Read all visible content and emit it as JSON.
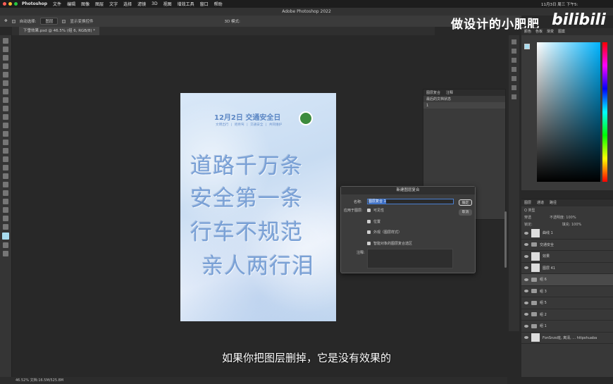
{
  "menubar": {
    "app": "Photoshop",
    "items": [
      "文件",
      "编辑",
      "图像",
      "图层",
      "文字",
      "选择",
      "滤镜",
      "3D",
      "视图",
      "增效工具",
      "窗口",
      "帮助"
    ],
    "clock": "11月3日 周三 下午5:"
  },
  "titlebar": {
    "title": "Adobe Photoshop 2022"
  },
  "options": {
    "auto_select": "自动选择:",
    "target": "图层",
    "show_transform": "显示变换控件",
    "mode3d": "3D 模式:"
  },
  "doc_tab": "下雪效果.psd @ 46.5% (组 6, RGB/8) *",
  "watermark": "做设计的小肥肥",
  "bili": "bilibili",
  "poster": {
    "heading": "12月2日 交通安全日",
    "sub": "文明出行 | 拒绝驾 | 交通安全 | 共同维护",
    "lines": [
      "道路千万条",
      "安全第一条",
      "行车不规范",
      "亲人两行泪"
    ]
  },
  "history": {
    "tabs": [
      "图层复合",
      "注释"
    ],
    "rows": [
      "最后的文档状态",
      "1"
    ]
  },
  "dialog": {
    "title": "新建图层复合",
    "name_label": "名称:",
    "name_value": "图层复合 1",
    "apply_label": "应用于图层:",
    "options": [
      "可见性",
      "位置",
      "外观（图层样式）",
      "智能对象的图层复合选区"
    ],
    "note_label": "注释:",
    "ok": "确定",
    "cancel": "取消"
  },
  "color_panel": {
    "tabs": [
      "颜色",
      "色板",
      "渐变",
      "图案"
    ],
    "fg": "#a8dcef"
  },
  "layers": {
    "tabs": [
      "图层",
      "通道",
      "路径"
    ],
    "kind": "Q 类型",
    "blend": "穿透",
    "opacity_label": "不透明度: 100%",
    "lock_label": "锁定:",
    "fill_label": "填充: 100%",
    "rows": [
      {
        "name": "曲线 1",
        "type": "adj"
      },
      {
        "name": "交通安全",
        "type": "folder"
      },
      {
        "name": "效果",
        "type": "fx"
      },
      {
        "name": "图层 41",
        "type": "layer"
      },
      {
        "name": "组 6",
        "type": "folder",
        "selected": true
      },
      {
        "name": "组 3",
        "type": "folder"
      },
      {
        "name": "组 5",
        "type": "folder"
      },
      {
        "name": "组 2",
        "type": "folder"
      },
      {
        "name": "组 1",
        "type": "folder"
      },
      {
        "name": "FonSnzo班, 离清, ... httpshuaba",
        "type": "layer"
      }
    ]
  },
  "statusbar": "46.52%     文档:16.5M/525.8M",
  "subtitle": "如果你把图层删掉，它是没有效果的"
}
